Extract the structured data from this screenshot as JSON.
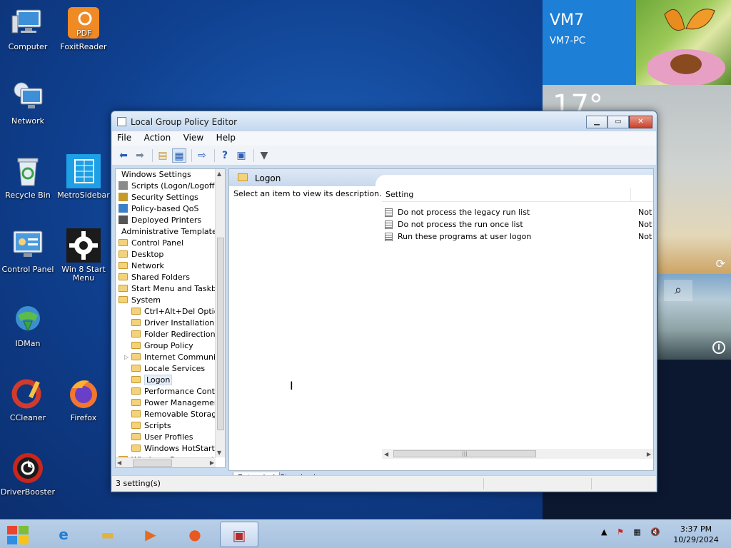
{
  "desktop": {
    "icons": [
      {
        "label": "Computer"
      },
      {
        "label": "FoxitReader"
      },
      {
        "label": "Network"
      },
      {
        "label": "Recycle Bin"
      },
      {
        "label": "MetroSidebar"
      },
      {
        "label": "Control Panel"
      },
      {
        "label": "Win 8 Start Menu"
      },
      {
        "label": "IDMan"
      },
      {
        "label": "CCleaner"
      },
      {
        "label": "Firefox"
      },
      {
        "label": "DriverBooster"
      }
    ],
    "foxit_badge": "PDF"
  },
  "tiles": {
    "user_name": "VM7",
    "pc_name": "VM7-PC",
    "temperature": "17°",
    "icons": {
      "refresh": "refresh-icon",
      "search": "search-icon",
      "info": "info-icon"
    }
  },
  "window": {
    "title": "Local Group Policy Editor",
    "menu": [
      "File",
      "Action",
      "View",
      "Help"
    ],
    "toolbar": [
      "back-icon",
      "forward-icon",
      "up-folder-icon",
      "show-hide-tree-icon",
      "export-list-icon",
      "help-icon",
      "properties-icon",
      "filter-icon"
    ],
    "tree": [
      {
        "label": "Windows Settings",
        "kind": "plain",
        "level": 0
      },
      {
        "label": "Scripts (Logon/Logoff)",
        "kind": "script",
        "level": 1
      },
      {
        "label": "Security Settings",
        "kind": "security",
        "level": 1
      },
      {
        "label": "Policy-based QoS",
        "kind": "chart",
        "level": 1
      },
      {
        "label": "Deployed Printers",
        "kind": "printer",
        "level": 1
      },
      {
        "label": "Administrative Templates",
        "kind": "plain",
        "level": 0
      },
      {
        "label": "Control Panel",
        "kind": "folder",
        "level": 1
      },
      {
        "label": "Desktop",
        "kind": "folder",
        "level": 1
      },
      {
        "label": "Network",
        "kind": "folder",
        "level": 1
      },
      {
        "label": "Shared Folders",
        "kind": "folder",
        "level": 1
      },
      {
        "label": "Start Menu and Taskbar",
        "kind": "folder",
        "level": 1
      },
      {
        "label": "System",
        "kind": "folder",
        "level": 1
      },
      {
        "label": "Ctrl+Alt+Del Options",
        "kind": "folder",
        "level": 2
      },
      {
        "label": "Driver Installation",
        "kind": "folder",
        "level": 2
      },
      {
        "label": "Folder Redirection",
        "kind": "folder",
        "level": 2
      },
      {
        "label": "Group Policy",
        "kind": "folder",
        "level": 2
      },
      {
        "label": "Internet Communication",
        "kind": "folder",
        "level": 2,
        "expandable": true
      },
      {
        "label": "Locale Services",
        "kind": "folder",
        "level": 2
      },
      {
        "label": "Logon",
        "kind": "folder",
        "level": 2,
        "selected": true
      },
      {
        "label": "Performance Control",
        "kind": "folder",
        "level": 2
      },
      {
        "label": "Power Management",
        "kind": "folder",
        "level": 2
      },
      {
        "label": "Removable Storage",
        "kind": "folder",
        "level": 2
      },
      {
        "label": "Scripts",
        "kind": "folder",
        "level": 2
      },
      {
        "label": "User Profiles",
        "kind": "folder",
        "level": 2
      },
      {
        "label": "Windows HotStart",
        "kind": "folder",
        "level": 2
      },
      {
        "label": "Windows Components",
        "kind": "folder",
        "level": 1
      }
    ],
    "right": {
      "header": "Logon",
      "description": "Select an item to view its description.",
      "column_setting": "Setting",
      "settings": [
        {
          "name": "Do not process the legacy run list",
          "state": "Not"
        },
        {
          "name": "Do not process the run once list",
          "state": "Not"
        },
        {
          "name": "Run these programs at user logon",
          "state": "Not"
        }
      ]
    },
    "tabs": [
      "Extended",
      "Standard"
    ],
    "status": "3 setting(s)"
  },
  "taskbar": {
    "apps": [
      "internet-explorer-icon",
      "file-explorer-icon",
      "media-player-icon",
      "firefox-icon",
      "group-policy-editor-icon"
    ],
    "tray_icons": [
      "show-hidden-icons-chevron",
      "action-center-flag-icon",
      "network-icon",
      "volume-muted-icon"
    ],
    "time": "3:37 PM",
    "date": "10/29/2024"
  }
}
